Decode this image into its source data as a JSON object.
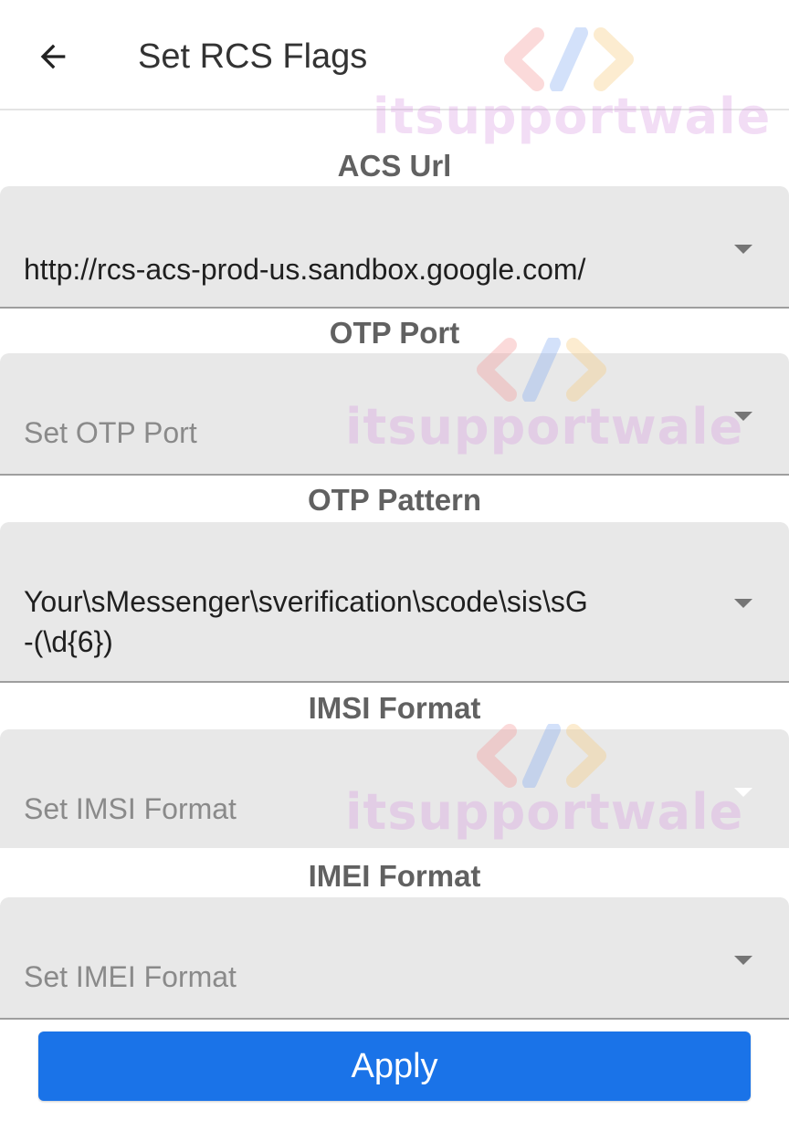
{
  "appbar": {
    "title": "Set RCS Flags",
    "back_icon": "arrow-back-icon"
  },
  "watermark": {
    "text": "itsupportwale",
    "logo_icon": "code-brackets-icon"
  },
  "fields": {
    "acs_url": {
      "label": "ACS Url",
      "value": "http://rcs-acs-prod-us.sandbox.google.com/",
      "placeholder": ""
    },
    "otp_port": {
      "label": "OTP Port",
      "value": "",
      "placeholder": "Set OTP Port"
    },
    "otp_pattern": {
      "label": "OTP Pattern",
      "value_line1": "Your\\sMessenger\\sverification\\scode\\sis\\sG",
      "value_line2": "-(\\d{6})",
      "placeholder": ""
    },
    "imsi_format": {
      "label": "IMSI Format",
      "value": "",
      "placeholder": "Set IMSI Format"
    },
    "imei_format": {
      "label": "IMEI Format",
      "value": "",
      "placeholder": "Set IMEI Format"
    }
  },
  "actions": {
    "apply_label": "Apply"
  },
  "colors": {
    "accent": "#1a73e8",
    "field_bg": "#e8e8e8",
    "label": "#616161"
  }
}
